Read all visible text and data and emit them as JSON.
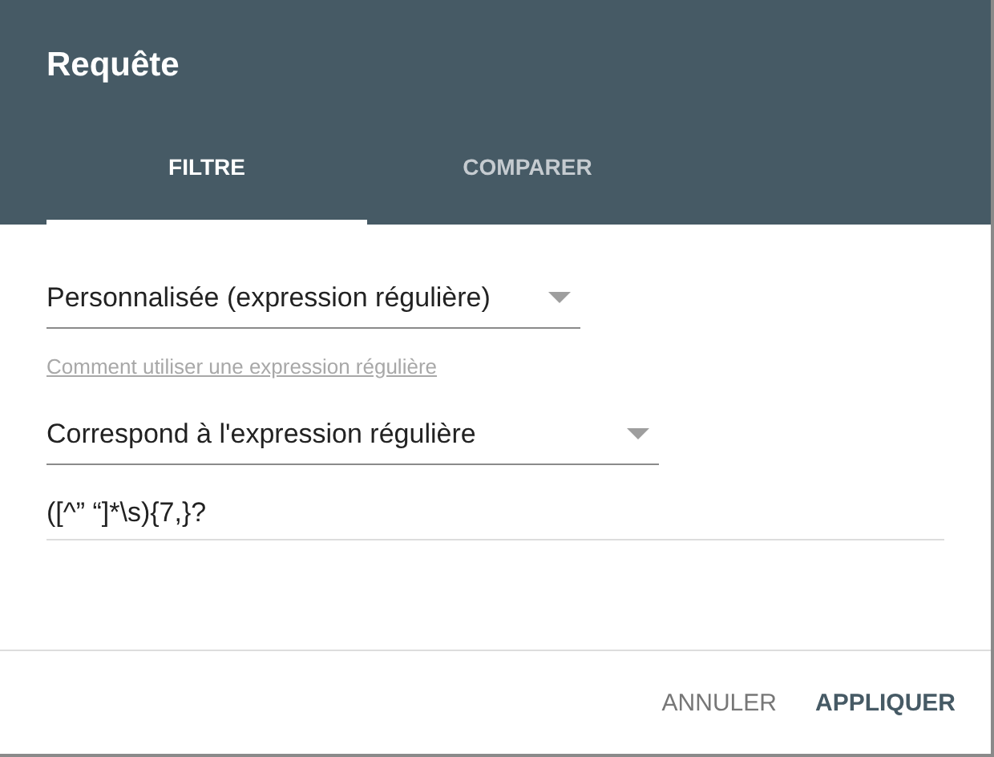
{
  "dialog": {
    "title": "Requête"
  },
  "tabs": [
    {
      "label": "FILTRE",
      "selected": true
    },
    {
      "label": "COMPARER",
      "selected": false
    }
  ],
  "match_type": {
    "value": "Personnalisée (expression régulière)"
  },
  "help_link": "Comment utiliser une expression régulière",
  "condition": {
    "value": "Correspond à l'expression régulière"
  },
  "expression": {
    "value": "([^” “]*\\s){7,}?"
  },
  "buttons": [
    {
      "label": "ANNULER",
      "kind": "secondary"
    },
    {
      "label": "APPLIQUER",
      "kind": "primary"
    }
  ]
}
